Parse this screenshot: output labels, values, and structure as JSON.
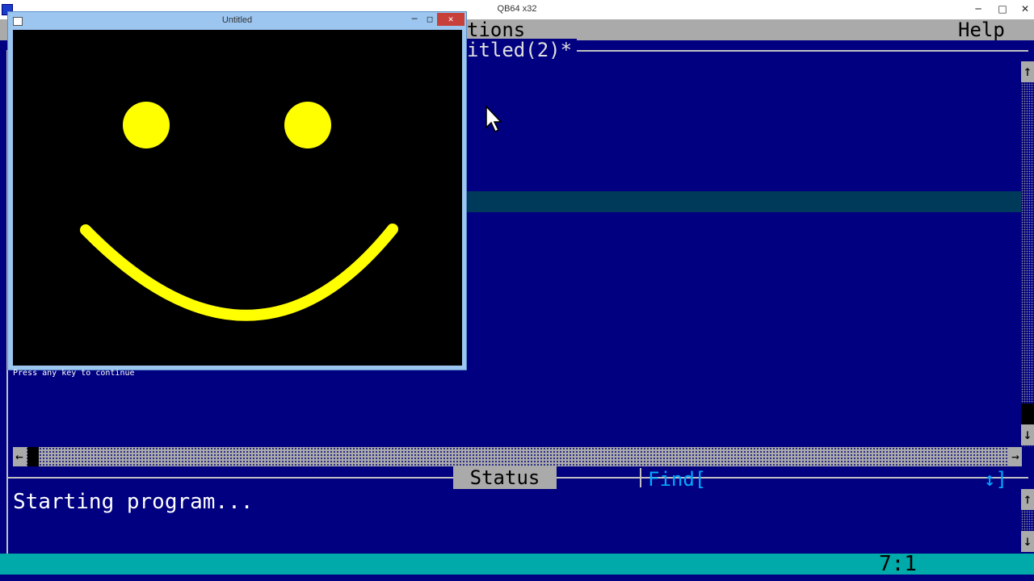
{
  "window": {
    "title": "QB64 x32",
    "minimize": "─",
    "maximize": "□",
    "close": "✕"
  },
  "menu": {
    "options": "tions",
    "help": "Help"
  },
  "editor": {
    "tab_title": "itled(2)*"
  },
  "scroll": {
    "up": "↑",
    "down": "↓",
    "left": "←",
    "right": "→"
  },
  "status": {
    "tab": "Status",
    "find": "Find[",
    "find_arrows": "↕]",
    "message": "Starting program..."
  },
  "bottom": {
    "position": "7:1"
  },
  "output_window": {
    "title": "Untitled",
    "minimize": "─",
    "maximize": "□",
    "close": "✕",
    "message": "Press any key to continue"
  },
  "colors": {
    "face": "#ffff00",
    "background": "#000080"
  }
}
